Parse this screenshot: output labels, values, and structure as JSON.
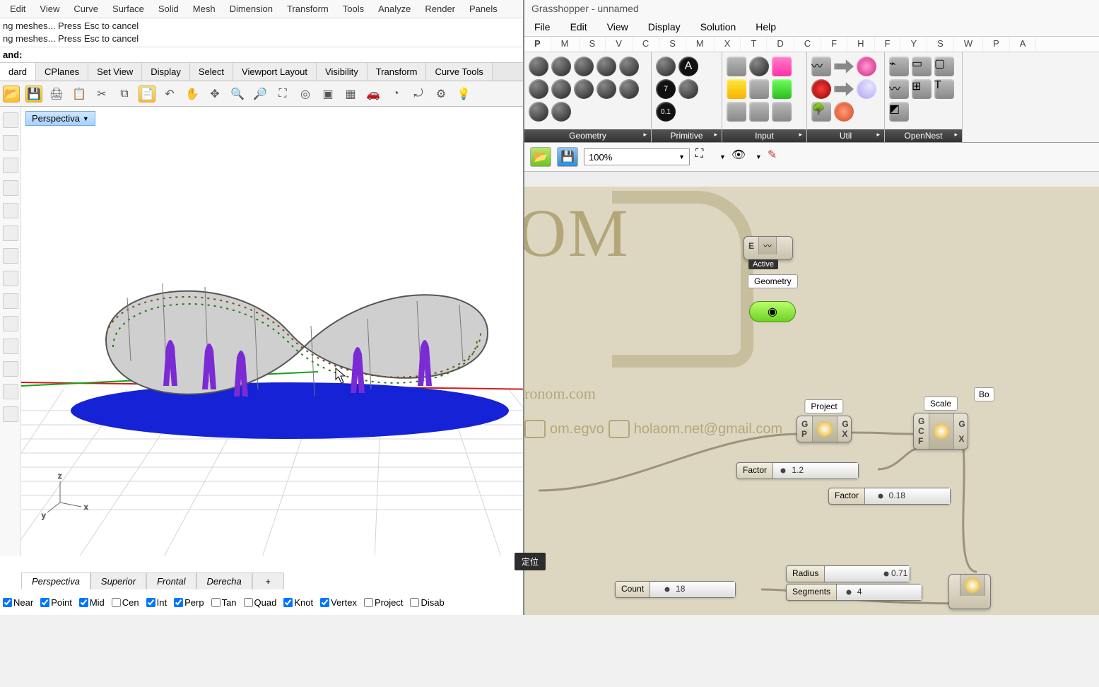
{
  "rhino": {
    "menus": [
      "Edit",
      "View",
      "Curve",
      "Surface",
      "Solid",
      "Mesh",
      "Dimension",
      "Transform",
      "Tools",
      "Analyze",
      "Render",
      "Panels"
    ],
    "log1": "ng meshes... Press Esc to cancel",
    "log2": "ng meshes... Press Esc to cancel",
    "cmd_prompt": "and:",
    "tabs": [
      "dard",
      "CPlanes",
      "Set View",
      "Display",
      "Select",
      "Viewport Layout",
      "Visibility",
      "Transform",
      "Curve Tools"
    ],
    "viewport_title": "Perspectiva",
    "bottom_tabs": [
      "Perspectiva",
      "Superior",
      "Frontal",
      "Derecha"
    ],
    "osnap": [
      {
        "label": "Near",
        "checked": true
      },
      {
        "label": "Point",
        "checked": true
      },
      {
        "label": "Mid",
        "checked": true
      },
      {
        "label": "Cen",
        "checked": false
      },
      {
        "label": "Int",
        "checked": true
      },
      {
        "label": "Perp",
        "checked": true
      },
      {
        "label": "Tan",
        "checked": false
      },
      {
        "label": "Quad",
        "checked": false
      },
      {
        "label": "Knot",
        "checked": true
      },
      {
        "label": "Vertex",
        "checked": true
      },
      {
        "label": "Project",
        "checked": false
      },
      {
        "label": "Disab",
        "checked": false
      }
    ],
    "axes": {
      "x": "x",
      "y": "y",
      "z": "z"
    }
  },
  "gh": {
    "window_title": "Grasshopper - unnamed",
    "menus": [
      "File",
      "Edit",
      "View",
      "Display",
      "Solution",
      "Help"
    ],
    "cat_tabs": [
      "P",
      "M",
      "S",
      "V",
      "C",
      "S",
      "M",
      "X",
      "T",
      "D",
      "C",
      "F",
      "H",
      "F",
      "Y",
      "S",
      "W",
      "P",
      "A"
    ],
    "ribbon_groups": [
      "Geometry",
      "Primitive",
      "Input",
      "Util",
      "OpenNest"
    ],
    "zoom": "100%",
    "watermark": {
      "logo": "OM",
      "url": "ronom.com",
      "yt": "om.egvo",
      "mail": "holaom.net@gmail.com"
    },
    "nodes": {
      "geom": {
        "top": "E",
        "tag": "Active",
        "label": "Geometry"
      },
      "project": {
        "label": "Project",
        "in": [
          "G",
          "P"
        ],
        "out": [
          "G",
          "X"
        ]
      },
      "scale": {
        "label": "Scale",
        "in": [
          "G",
          "C",
          "F"
        ],
        "out": [
          "G",
          "X"
        ]
      },
      "extra": {
        "label": "Bo"
      }
    },
    "sliders": {
      "factor1": {
        "label": "Factor",
        "value": "1.2",
        "pos": 12
      },
      "factor2": {
        "label": "Factor",
        "value": "0.18",
        "pos": 18
      },
      "count": {
        "label": "Count",
        "value": "18",
        "pos": 20
      },
      "radius": {
        "label": "Radius",
        "value": "0.71",
        "pos": 72
      },
      "segments": {
        "label": "Segments",
        "value": "4",
        "pos": 14
      }
    }
  },
  "tooltip": "定位"
}
